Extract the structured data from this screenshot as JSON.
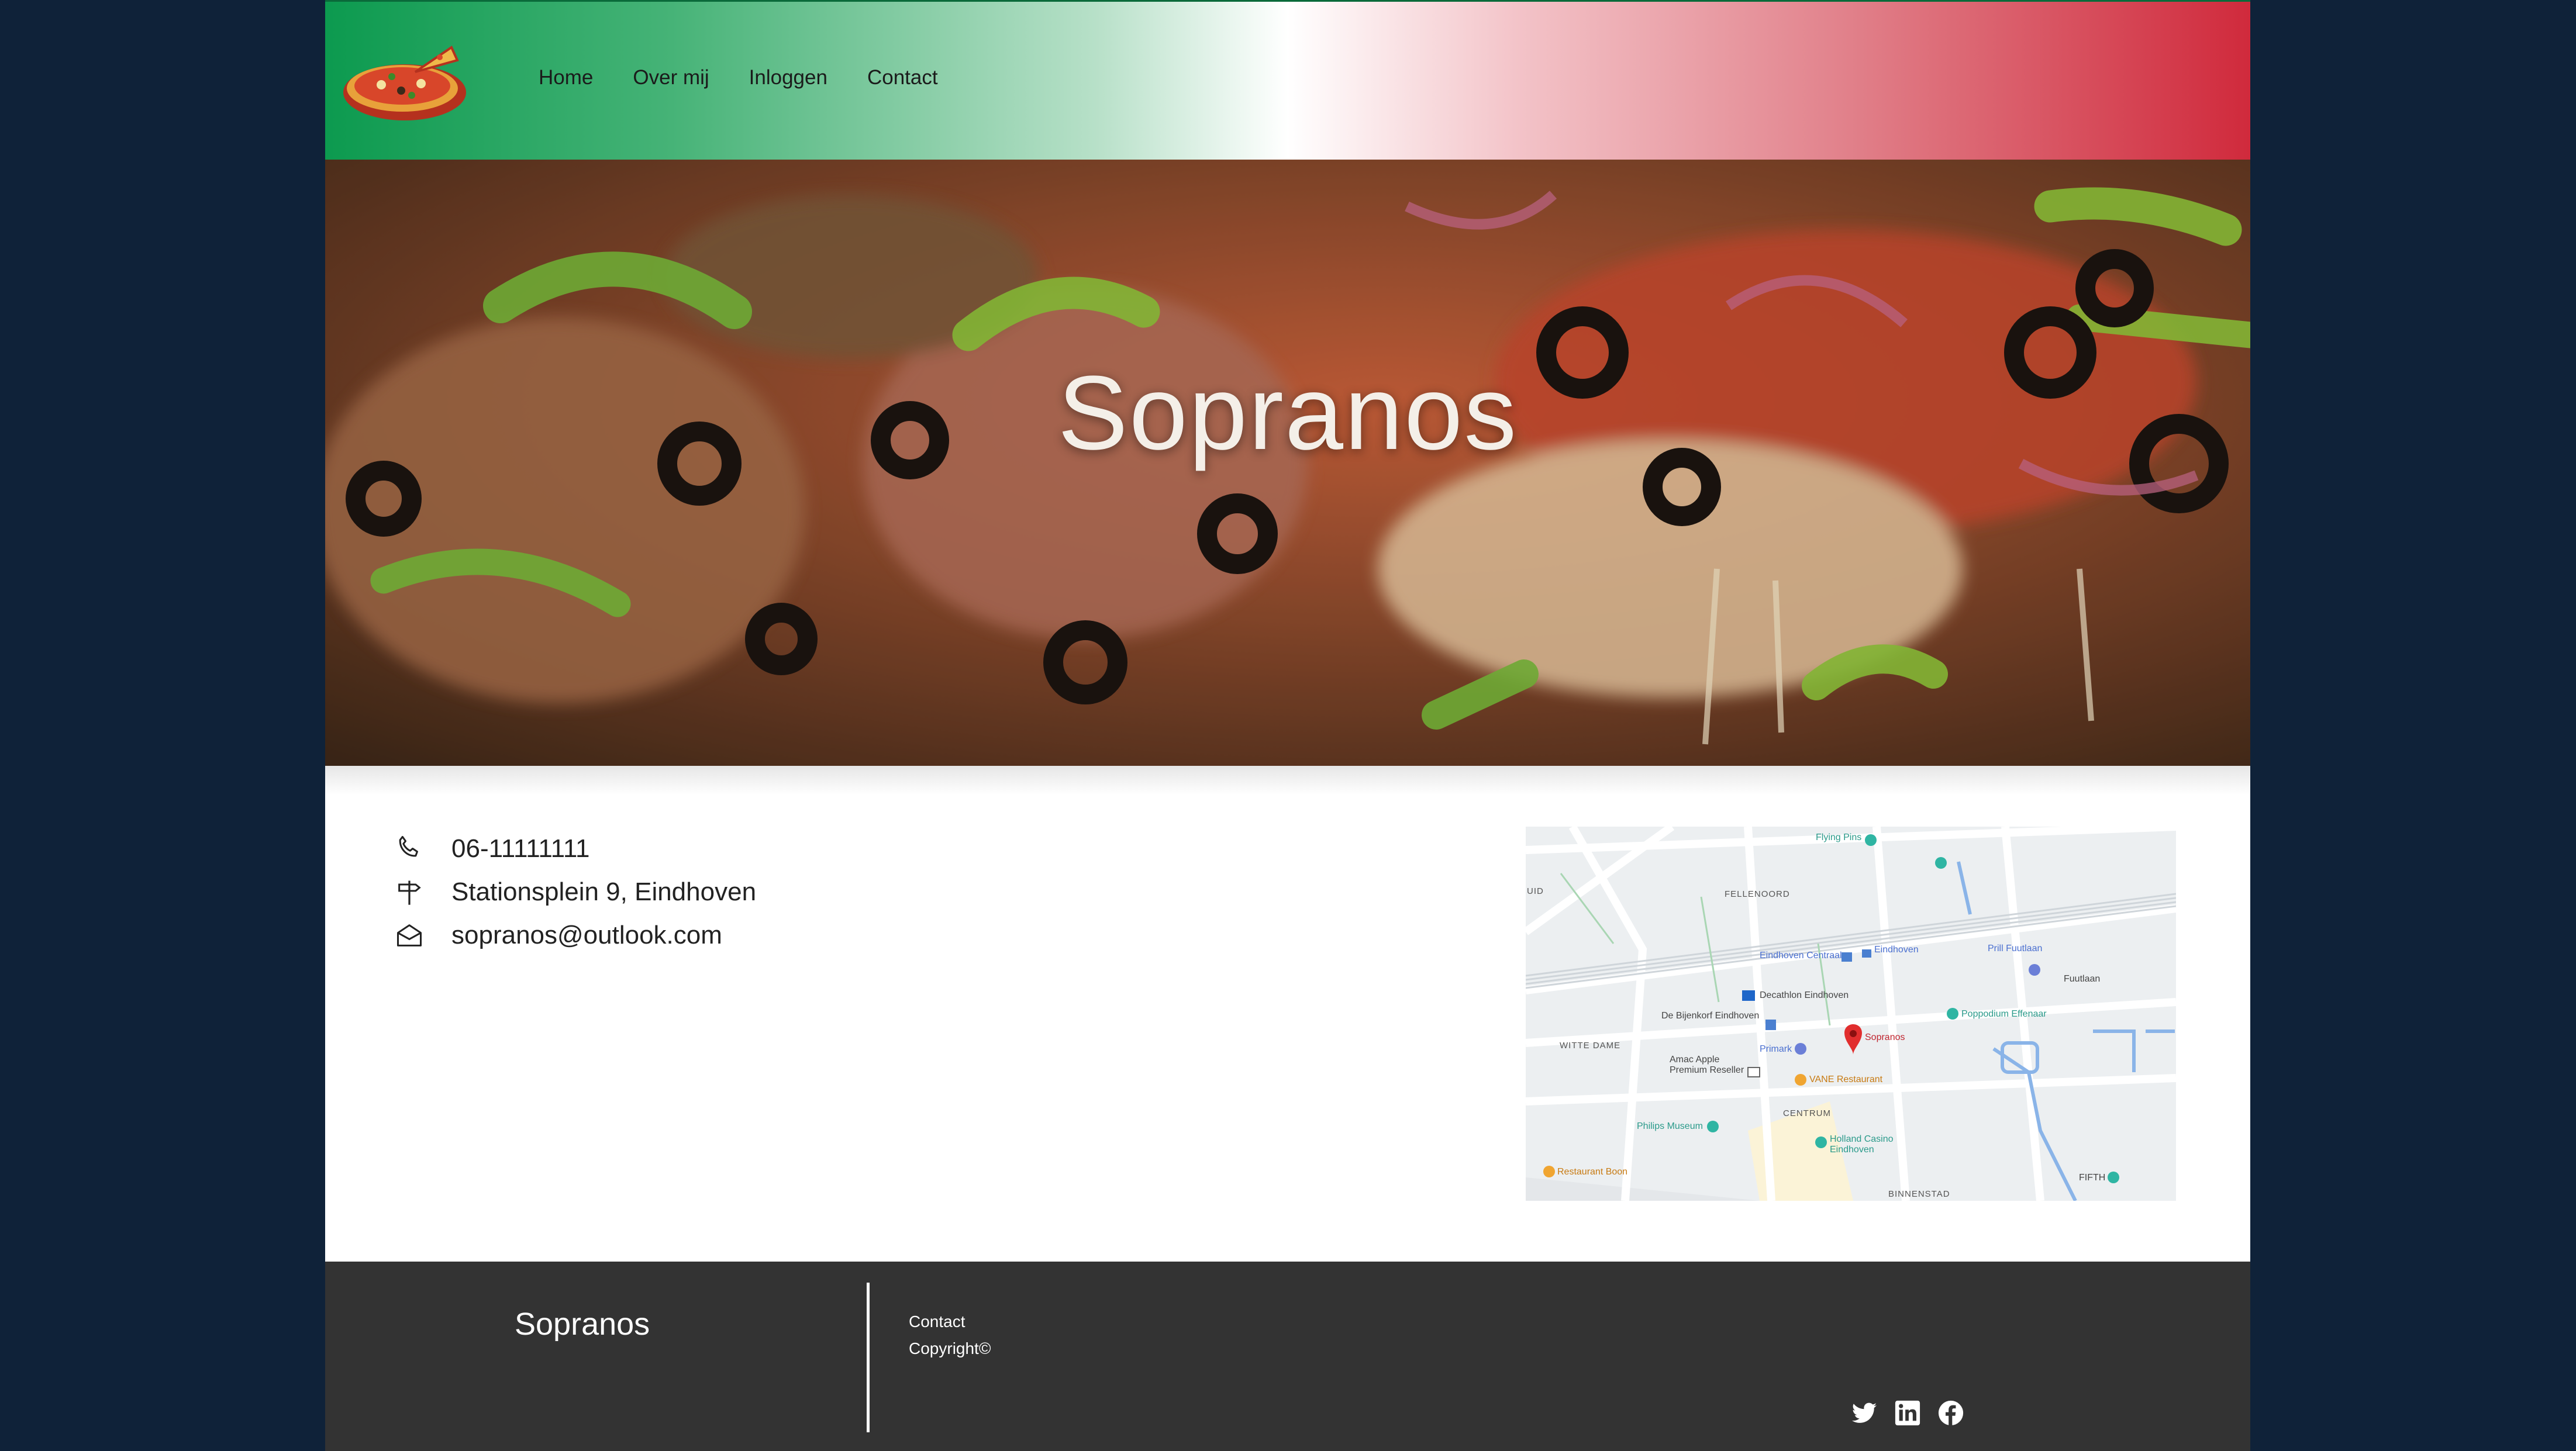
{
  "nav": {
    "links": [
      "Home",
      "Over mij",
      "Inloggen",
      "Contact"
    ]
  },
  "hero": {
    "title": "Sopranos"
  },
  "contact": {
    "phone": "06-11111111",
    "address": "Stationsplein 9, Eindhoven",
    "email": "sopranos@outlook.com"
  },
  "map": {
    "labels": {
      "flying_pins": "Flying Pins",
      "fellenoord": "FELLENOORD",
      "eindhoven_centraal": "Eindhoven Centraal",
      "eindhoven": "Eindhoven",
      "prill_fuutlaan": "Prill Fuutlaan",
      "fuutlaan": "Fuutlaan",
      "decathlon": "Decathlon Eindhoven",
      "witte_dame": "WITTE DAME",
      "bijenkorf": "De Bijenkorf Eindhoven",
      "sopranos": "Sopranos",
      "poppodium": "Poppodium Effenaar",
      "primark": "Primark",
      "amac": "Amac Apple Premium Reseller",
      "vane": "VANE Restaurant",
      "centrum": "CENTRUM",
      "philips_museum": "Philips Museum",
      "holland_casino": "Holland Casino Eindhoven",
      "restaurant_boon": "Restaurant Boon",
      "binnenstad": "BINNENSTAD",
      "fifth": "FIFTH",
      "uid": "UID"
    }
  },
  "footer": {
    "brand": "Sopranos",
    "links": [
      "Contact",
      "Copyright©"
    ]
  },
  "colors": {
    "page_bg": "#0f2239",
    "italy_green": "#0c9a4f",
    "italy_red": "#d02a3c",
    "footer_bg": "#333333"
  },
  "icons": [
    "phone-icon",
    "signpost-icon",
    "envelope-icon",
    "twitter-icon",
    "linkedin-icon",
    "facebook-icon"
  ]
}
